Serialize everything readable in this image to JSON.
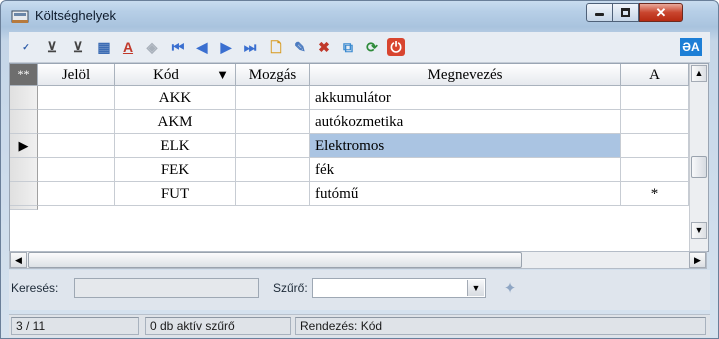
{
  "window": {
    "title": "Költséghelyek"
  },
  "toolbar": {
    "lang_label": "ƏA"
  },
  "grid": {
    "corner_label": "**",
    "columns": [
      "Jelöl",
      "Kód",
      "Mozgás",
      "Megnevezés",
      "A"
    ],
    "sort_indicator": "▼",
    "rows": [
      {
        "jelol": "",
        "kod": "AKK",
        "mozgas": "",
        "megnevezes": "akkumulátor",
        "a": ""
      },
      {
        "jelol": "",
        "kod": "AKM",
        "mozgas": "",
        "megnevezes": "autókozmetika",
        "a": ""
      },
      {
        "jelol": "",
        "kod": "ELK",
        "mozgas": "",
        "megnevezes": "Elektromos",
        "a": "",
        "current_marker": "▶"
      },
      {
        "jelol": "",
        "kod": "FEK",
        "mozgas": "",
        "megnevezes": "fék",
        "a": ""
      },
      {
        "jelol": "",
        "kod": "FUT",
        "mozgas": "",
        "megnevezes": "futómű",
        "a": "*"
      }
    ]
  },
  "filter": {
    "search_label": "Keresés:",
    "search_value": "",
    "filter_label": "Szűrő:",
    "filter_value": ""
  },
  "status": {
    "position": "3 / 11",
    "active_filters": "0 db aktív szűrő",
    "sort": "Rendezés: Kód"
  }
}
